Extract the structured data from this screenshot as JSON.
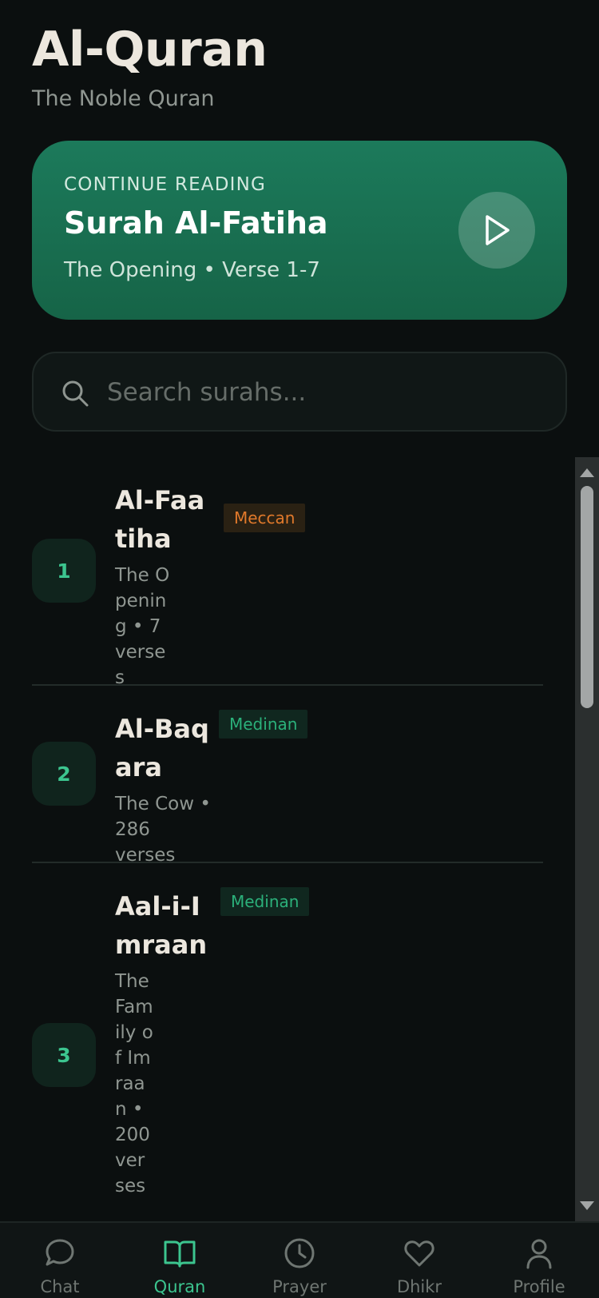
{
  "header": {
    "title": "Al-Quran",
    "subtitle": "The Noble Quran"
  },
  "continue_reading": {
    "label": "CONTINUE READING",
    "surah": "Surah Al-Fatiha",
    "detail": "The Opening • Verse 1-7",
    "play_icon": "play-icon"
  },
  "search": {
    "placeholder": "Search surahs...",
    "value": "",
    "icon": "search-icon"
  },
  "surahs": [
    {
      "number": "1",
      "name": "Al-Faatiha",
      "meaning": "The Opening • 7 verses",
      "type": "Meccan"
    },
    {
      "number": "2",
      "name": "Al-Baqara",
      "meaning": "The Cow • 286 verses",
      "type": "Medinan"
    },
    {
      "number": "3",
      "name": "Aal-i-Imraan",
      "meaning": "The Family of Imraan • 200 verses",
      "type": "Medinan"
    }
  ],
  "tabs": [
    {
      "label": "Chat",
      "icon": "chat-bubble-icon",
      "active": false
    },
    {
      "label": "Quran",
      "icon": "open-book-icon",
      "active": true
    },
    {
      "label": "Prayer",
      "icon": "clock-icon",
      "active": false
    },
    {
      "label": "Dhikr",
      "icon": "heart-icon",
      "active": false
    },
    {
      "label": "Profile",
      "icon": "person-icon",
      "active": false
    }
  ],
  "colors": {
    "background": "#0b0f0f",
    "accent": "#3cc58f",
    "card": "#1c7a5b",
    "meccan": "#e0792b",
    "medinan": "#2bb07a"
  }
}
